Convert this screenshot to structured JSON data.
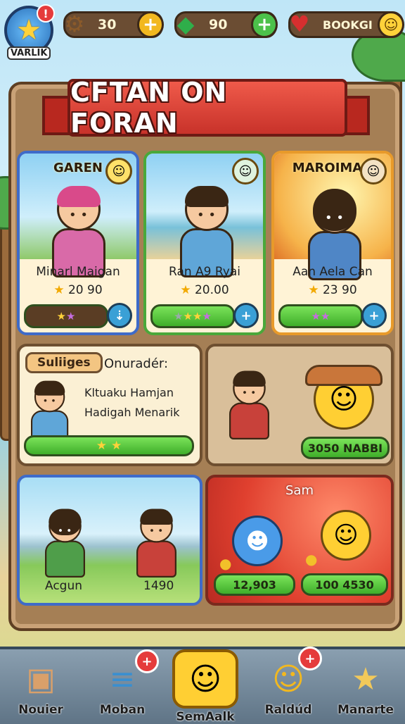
{
  "hud": {
    "avatar_label": "VARLIK",
    "avatar_badge": "!",
    "resources": [
      {
        "icon": "gear-coin-icon",
        "value": "30"
      },
      {
        "icon": "green-gem-icon",
        "value": "90"
      },
      {
        "icon": "heart-icon",
        "value": "BOOKGI"
      }
    ]
  },
  "banner": {
    "title": "CFTAN ON FORAN"
  },
  "cards": [
    {
      "tag": "GAREN",
      "name": "Minarl Maigan",
      "score": "20 90",
      "border": "#3e6bc9"
    },
    {
      "tag": "",
      "name": "Ran A9 Ryai",
      "score": "20.00",
      "border": "#4aa83a"
    },
    {
      "tag": "MAROIMAN",
      "name": "Aan Aela Can",
      "score": "23 90",
      "border": "#e89a2a"
    }
  ],
  "mid_left": {
    "tab": "Suliiges",
    "heading": "Onuradér:",
    "line1": "Kltuaku Hamjan",
    "line2": "Hadigah Menarik"
  },
  "mid_right": {
    "value": "3050 NABBI"
  },
  "bottom_left": {
    "left_label": "Acgun",
    "right_label": "1490"
  },
  "bottom_right": {
    "title": "Sam",
    "left_value": "12,903",
    "right_value": "100 4530"
  },
  "nav": [
    {
      "label": "Nouier",
      "badge": ""
    },
    {
      "label": "Moban",
      "badge": "+"
    },
    {
      "label": "SemAalk",
      "badge": ""
    },
    {
      "label": "Raldúd",
      "badge": "+"
    },
    {
      "label": "Manarte",
      "badge": ""
    }
  ]
}
